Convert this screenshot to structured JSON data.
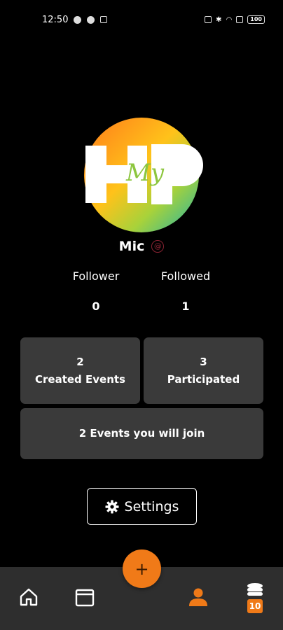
{
  "status_bar": {
    "time": "12:50",
    "battery": "100"
  },
  "profile": {
    "username": "Mic"
  },
  "stats": {
    "follower_label": "Follower",
    "follower_value": "0",
    "followed_label": "Followed",
    "followed_value": "1"
  },
  "cards": {
    "created_count": "2",
    "created_label": "Created Events",
    "participated_count": "3",
    "participated_label": "Participated",
    "join_label": "2 Events you will join"
  },
  "settings": {
    "label": "Settings"
  },
  "bottom_nav": {
    "items": [
      "home-icon",
      "calendar-icon",
      "add-icon",
      "profile-icon",
      "coins-icon"
    ],
    "coin_count": "10",
    "accent_color": "#f07a18"
  }
}
